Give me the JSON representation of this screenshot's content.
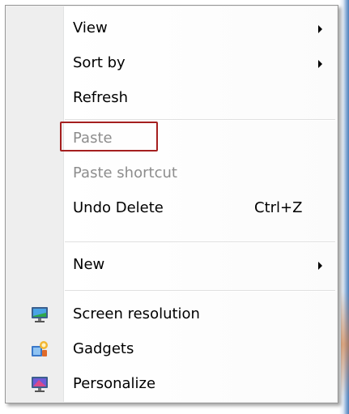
{
  "context_menu": {
    "items": [
      {
        "label": "View",
        "submenu": true,
        "disabled": false
      },
      {
        "label": "Sort by",
        "submenu": true,
        "disabled": false
      },
      {
        "label": "Refresh",
        "submenu": false,
        "disabled": false
      },
      {
        "label": "Paste",
        "submenu": false,
        "disabled": true,
        "highlighted": true
      },
      {
        "label": "Paste shortcut",
        "submenu": false,
        "disabled": true
      },
      {
        "label": "Undo Delete",
        "shortcut": "Ctrl+Z",
        "submenu": false,
        "disabled": false
      },
      {
        "label": "New",
        "submenu": true,
        "disabled": false
      },
      {
        "label": "Screen resolution",
        "icon": "monitor-icon",
        "disabled": false
      },
      {
        "label": "Gadgets",
        "icon": "gadgets-icon",
        "disabled": false
      },
      {
        "label": "Personalize",
        "icon": "personalize-icon",
        "disabled": false
      }
    ]
  },
  "colors": {
    "highlight_border": "#a51f1f",
    "disabled_text": "#8d8d8d",
    "menu_background": "#f0f0f0"
  }
}
